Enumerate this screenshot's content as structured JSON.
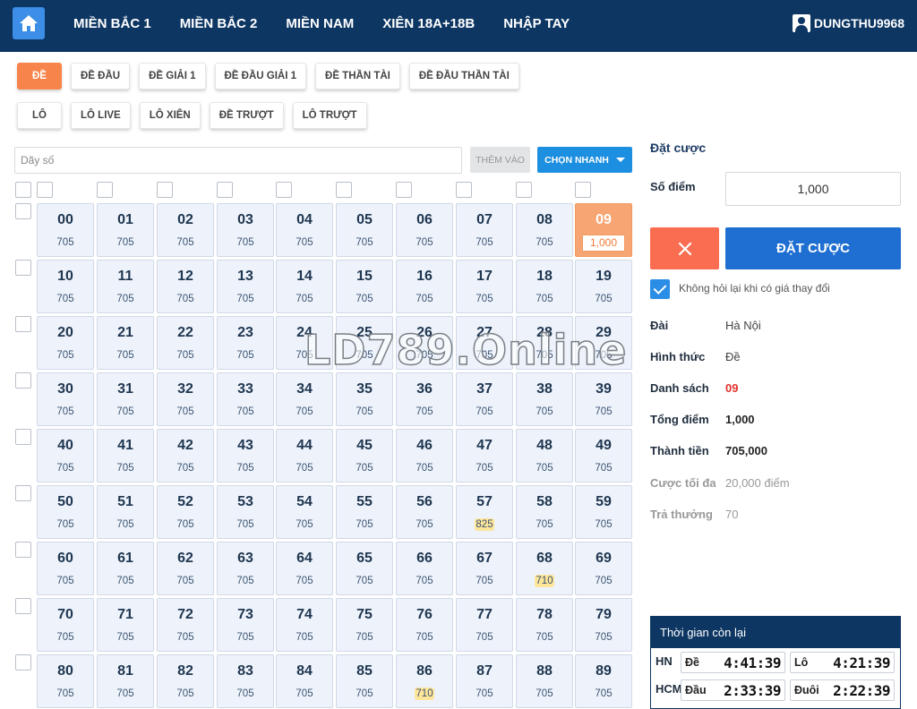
{
  "nav": {
    "items": [
      "MIỀN BẮC 1",
      "MIỀN BẮC 2",
      "MIỀN NAM",
      "XIÊN 18A+18B",
      "NHẬP TAY"
    ],
    "username": "DUNGTHU9968"
  },
  "bet_types": {
    "row1": [
      "ĐỀ",
      "ĐỀ ĐẦU",
      "ĐỀ GIẢI 1",
      "ĐỀ ĐẦU GIẢI 1",
      "ĐỀ THẦN TÀI",
      "ĐỀ ĐẦU THẦN TÀI"
    ],
    "row2": [
      "LÔ",
      "LÔ LIVE",
      "LÔ XIÊN",
      "ĐỀ TRƯỢT",
      "LÔ TRƯỢT"
    ],
    "active": "ĐỀ"
  },
  "number_input": {
    "placeholder": "Dãy số"
  },
  "add_label": "THÊM VÀO",
  "quick_label": "CHỌN NHANH",
  "grid": {
    "default_rate": "705",
    "special_rates": {
      "57": "825",
      "68": "710",
      "86": "710"
    },
    "selected": "09",
    "selected_amount": "1,000"
  },
  "watermark": "LD789.Online",
  "panel": {
    "title": "Đặt cược",
    "score_label": "Số điểm",
    "score_value": "1,000",
    "bet_label": "ĐẶT CƯỢC",
    "no_ask_label": "Không hỏi lại khi có giá thay đổi",
    "info": [
      {
        "k": "Đài",
        "v": "Hà Nội",
        "style": ""
      },
      {
        "k": "Hình thức",
        "v": "Đề",
        "style": ""
      },
      {
        "k": "Danh sách",
        "v": "09",
        "style": "red"
      },
      {
        "k": "Tổng điểm",
        "v": "1,000",
        "style": "bold"
      },
      {
        "k": "Thành tiền",
        "v": "705,000",
        "style": "bold"
      },
      {
        "k": "Cược tối đa",
        "v": "20,000 điểm",
        "style": "muted"
      },
      {
        "k": "Trả thưởng",
        "v": "70",
        "style": "muted"
      }
    ]
  },
  "timer": {
    "title": "Thời gian còn lại",
    "rows": [
      {
        "region": "HN",
        "a_label": "Đề",
        "a_time": "4:41:39",
        "b_label": "Lô",
        "b_time": "4:21:39"
      },
      {
        "region": "HCM",
        "a_label": "Đầu",
        "a_time": "2:33:39",
        "b_label": "Đuôi",
        "b_time": "2:22:39"
      }
    ]
  },
  "colors": {
    "topbar": "#0d3663",
    "accent_orange": "#f7844a",
    "primary_blue": "#1e6fd1",
    "danger": "#fa6d50"
  }
}
